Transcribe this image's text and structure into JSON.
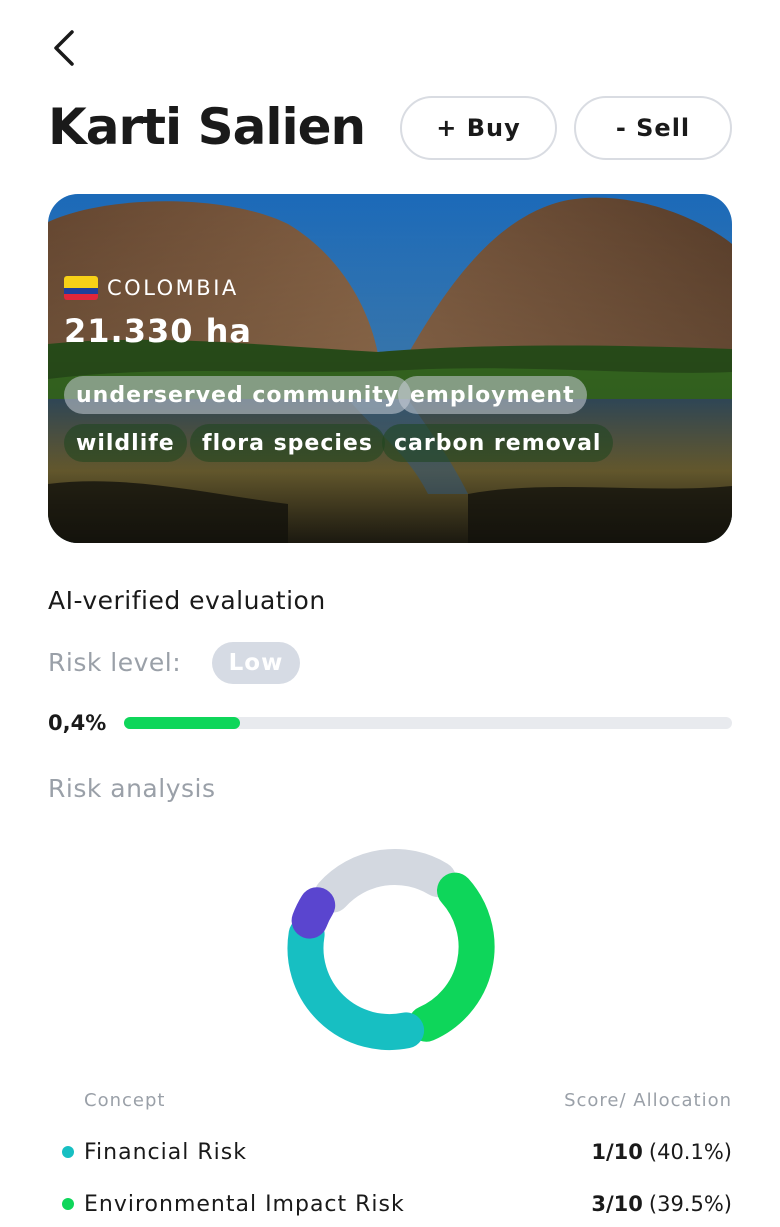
{
  "header": {
    "title": "Karti Salien",
    "buy_label": "+ Buy",
    "sell_label": "- Sell"
  },
  "hero": {
    "country": "COLOMBIA",
    "area": "21.330 ha",
    "tags": [
      "underserved community",
      "employment",
      "wildlife",
      "flora species",
      "carbon removal"
    ]
  },
  "evaluation": {
    "heading": "AI-verified evaluation",
    "risk_label": "Risk level:",
    "risk_value": "Low",
    "risk_percent_text": "0,4%",
    "risk_progress_fraction": 0.19
  },
  "analysis": {
    "heading": "Risk analysis",
    "col_concept": "Concept",
    "col_score": "Score/ Allocation",
    "rows": [
      {
        "label": "Financial Risk",
        "score": "1/10",
        "alloc": "(40.1%)",
        "color": "#17bfc2"
      },
      {
        "label": "Environmental Impact Risk",
        "score": "3/10",
        "alloc": "(39.5%)",
        "color": "#0ed65a"
      }
    ]
  },
  "colors": {
    "accent_green": "#0ed65a",
    "teal": "#17bfc2",
    "purple": "#5a45cf",
    "grey_segment": "#d3d8e0"
  }
}
